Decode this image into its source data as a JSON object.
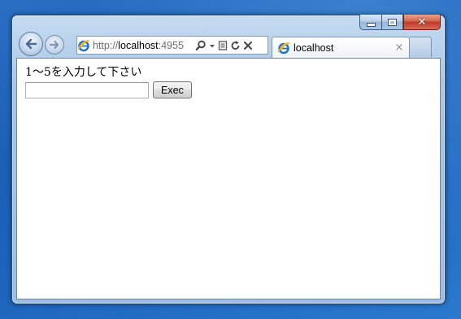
{
  "window": {
    "caption_buttons": {
      "minimize_icon": "minimize-icon",
      "maximize_icon": "maximize-icon",
      "close_icon": "close-icon",
      "close_glyph": "✕"
    }
  },
  "navigation": {
    "back_icon": "back-arrow-icon",
    "forward_icon": "forward-arrow-icon"
  },
  "address_bar": {
    "protocol": "http://",
    "host": "localhost",
    "port": ":4955",
    "icons": [
      "ie-logo-icon",
      "search-icon",
      "dropdown-arrow-icon",
      "compatibility-view-icon",
      "refresh-icon",
      "stop-icon"
    ]
  },
  "tab": {
    "title": "localhost",
    "close_glyph": "×"
  },
  "page": {
    "prompt": "1～5を入力して下さい",
    "input": {
      "value": "",
      "placeholder": ""
    },
    "exec_button_label": "Exec"
  },
  "colors": {
    "desktop": "#1e64bd",
    "window_frame": "#a9c6e6",
    "close_button": "#c0392b",
    "ie_blue": "#1e6fc7",
    "ie_gold": "#f0b323"
  }
}
